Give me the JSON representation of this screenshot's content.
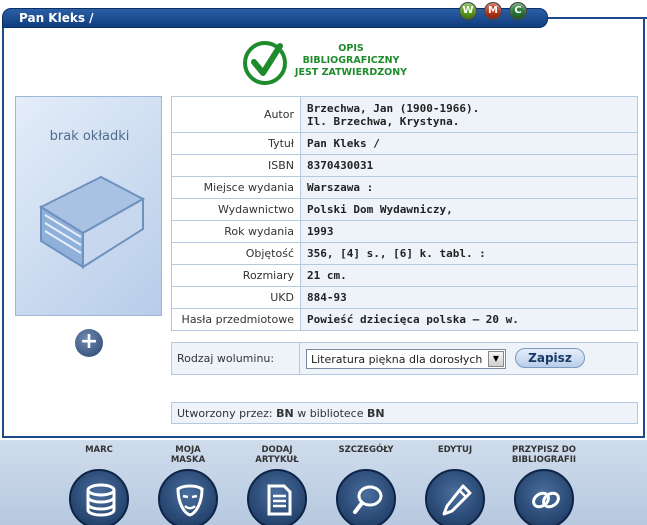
{
  "window": {
    "title": "Pan Kleks /",
    "badges": [
      {
        "letter": "W",
        "color": "#5fa61e"
      },
      {
        "letter": "M",
        "color": "#c0391b"
      },
      {
        "letter": "C",
        "color": "#2e7f3d"
      }
    ]
  },
  "stamp": {
    "line1": "OPIS",
    "line2": "BIBLIOGRAFICZNY",
    "line3": "JEST ZATWIERDZONY",
    "color": "#1e8b2c",
    "icon": "checkmark-icon"
  },
  "cover": {
    "placeholder_text": "brak okładki",
    "icon": "book-icon",
    "add_icon": "plus-icon"
  },
  "details": [
    {
      "label": "Autor",
      "value_line1": "Brzechwa, Jan (1900-1966).",
      "value_line2": "Il. Brzechwa, Krystyna."
    },
    {
      "label": "Tytuł",
      "value": "Pan Kleks /"
    },
    {
      "label": "ISBN",
      "value": "8370430031"
    },
    {
      "label": "Miejsce wydania",
      "value": "Warszawa :"
    },
    {
      "label": "Wydawnictwo",
      "value": "Polski Dom Wydawniczy,"
    },
    {
      "label": "Rok wydania",
      "value": "1993"
    },
    {
      "label": "Objętość",
      "value": "356, [4] s., [6] k. tabl. :"
    },
    {
      "label": "Rozmiary",
      "value": "21 cm."
    },
    {
      "label": "UKD",
      "value": "884-93"
    },
    {
      "label": "Hasła przedmiotowe",
      "value": "Powieść dziecięca polska – 20 w."
    }
  ],
  "volume": {
    "label": "Rodzaj woluminu:",
    "selected": "Literatura piękna dla dorosłych",
    "save_label": "Zapisz"
  },
  "created": {
    "prefix": "Utworzony przez:",
    "user": "BN",
    "middle": "w bibliotece",
    "library": "BN"
  },
  "toolbar": [
    {
      "label_line1": "MARC",
      "label_line2": "",
      "icon": "database-icon"
    },
    {
      "label_line1": "MOJA",
      "label_line2": "MASKA",
      "icon": "mask-icon"
    },
    {
      "label_line1": "DODAJ",
      "label_line2": "ARTYKUŁ",
      "icon": "document-icon"
    },
    {
      "label_line1": "SZCZEGÓŁY",
      "label_line2": "",
      "icon": "magnifier-icon"
    },
    {
      "label_line1": "EDYTUJ",
      "label_line2": "",
      "icon": "pencil-icon"
    },
    {
      "label_line1": "PRZYPISZ DO",
      "label_line2": "BIBLIOGRAFII",
      "icon": "link-icon"
    }
  ]
}
